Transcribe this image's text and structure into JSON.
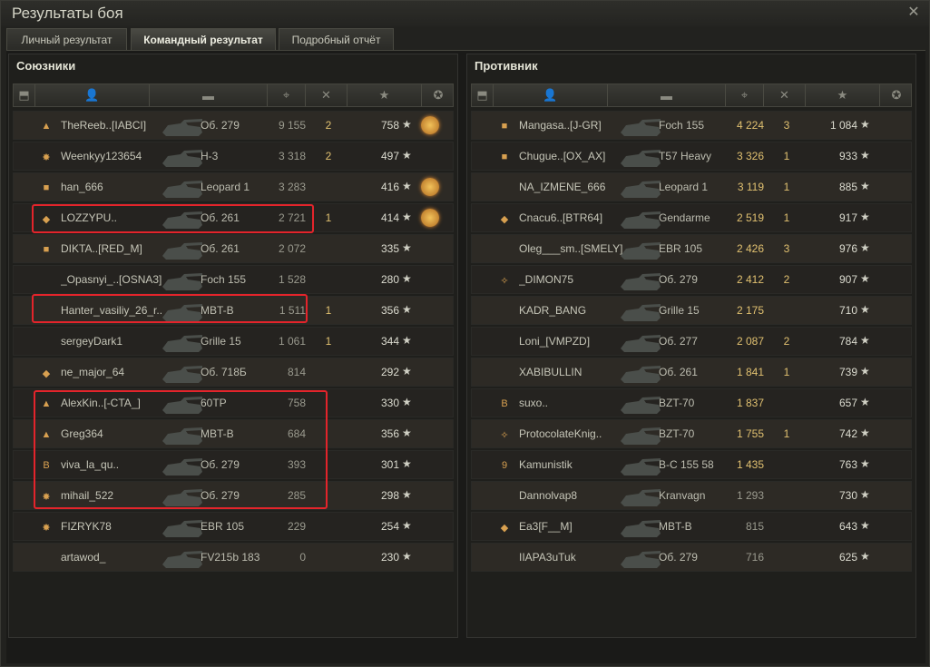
{
  "window": {
    "title": "Результаты боя"
  },
  "tabs": [
    {
      "label": "Личный результат"
    },
    {
      "label": "Командный результат"
    },
    {
      "label": "Подробный отчёт"
    }
  ],
  "allies": {
    "title": "Союзники",
    "rows": [
      {
        "name": "TheReeb..[IABCI]",
        "tank": "Об. 279",
        "damage": "9 155",
        "kills": "2",
        "xp": "758",
        "medal": true,
        "badge": "▲"
      },
      {
        "name": "Weenkyy123654",
        "tank": "Н-3",
        "damage": "3 318",
        "kills": "2",
        "xp": "497",
        "medal": false,
        "badge": "✸"
      },
      {
        "name": "han_666",
        "tank": "Leopard 1",
        "damage": "3 283",
        "kills": "",
        "xp": "416",
        "medal": true,
        "badge": "■"
      },
      {
        "name": "LOZZYPU..",
        "tank": "Об. 261",
        "damage": "2 721",
        "kills": "1",
        "xp": "414",
        "medal": true,
        "badge": "◆"
      },
      {
        "name": "DIKTA..[RED_M]",
        "tank": "Об. 261",
        "damage": "2 072",
        "kills": "",
        "xp": "335",
        "medal": false,
        "badge": "■"
      },
      {
        "name": "_Opasnyi_..[OSNA3]",
        "tank": "Foch 155",
        "damage": "1 528",
        "kills": "",
        "xp": "280",
        "medal": false,
        "badge": ""
      },
      {
        "name": "Hanter_vasiliy_26_r..",
        "tank": "MBT-B",
        "damage": "1 511",
        "kills": "1",
        "xp": "356",
        "medal": false,
        "badge": ""
      },
      {
        "name": "sergeyDark1",
        "tank": "Grille 15",
        "damage": "1 061",
        "kills": "1",
        "xp": "344",
        "medal": false,
        "badge": ""
      },
      {
        "name": "ne_major_64",
        "tank": "Об. 718Б",
        "damage": "814",
        "kills": "",
        "xp": "292",
        "medal": false,
        "badge": "◆"
      },
      {
        "name": "AlexKin..[-CTA_]",
        "tank": "60TP",
        "damage": "758",
        "kills": "",
        "xp": "330",
        "medal": false,
        "badge": "▲"
      },
      {
        "name": "Greg364",
        "tank": "MBT-B",
        "damage": "684",
        "kills": "",
        "xp": "356",
        "medal": false,
        "badge": "▲"
      },
      {
        "name": "viva_la_qu..",
        "tank": "Об. 279",
        "damage": "393",
        "kills": "",
        "xp": "301",
        "medal": false,
        "badge": "B"
      },
      {
        "name": "mihail_522",
        "tank": "Об. 279",
        "damage": "285",
        "kills": "",
        "xp": "298",
        "medal": false,
        "badge": "✸"
      },
      {
        "name": "FIZRYK78",
        "tank": "EBR 105",
        "damage": "229",
        "kills": "",
        "xp": "254",
        "medal": false,
        "badge": "✸"
      },
      {
        "name": "artawod_",
        "tank": "FV215b 183",
        "damage": "0",
        "kills": "",
        "xp": "230",
        "medal": false,
        "badge": ""
      }
    ]
  },
  "enemies": {
    "title": "Противник",
    "rows": [
      {
        "name": "Mangasa..[J-GR]",
        "tank": "Foch 155",
        "damage": "4 224",
        "kills": "3",
        "xp": "1 084",
        "badge": "■"
      },
      {
        "name": "Chugue..[OX_AX]",
        "tank": "T57 Heavy",
        "damage": "3 326",
        "kills": "1",
        "xp": "933",
        "badge": "■"
      },
      {
        "name": "NA_IZMENE_666",
        "tank": "Leopard 1",
        "damage": "3 119",
        "kills": "1",
        "xp": "885",
        "badge": ""
      },
      {
        "name": "Cnacu6..[BTR64]",
        "tank": "Gendarme",
        "damage": "2 519",
        "kills": "1",
        "xp": "917",
        "badge": "◆"
      },
      {
        "name": "Oleg___sm..[SMELY]",
        "tank": "EBR 105",
        "damage": "2 426",
        "kills": "3",
        "xp": "976",
        "badge": ""
      },
      {
        "name": "_DIMON75",
        "tank": "Об. 279",
        "damage": "2 412",
        "kills": "2",
        "xp": "907",
        "badge": "✧"
      },
      {
        "name": "KADR_BANG",
        "tank": "Grille 15",
        "damage": "2 175",
        "kills": "",
        "xp": "710",
        "badge": ""
      },
      {
        "name": "Loni_[VMPZD]",
        "tank": "Об. 277",
        "damage": "2 087",
        "kills": "2",
        "xp": "784",
        "badge": ""
      },
      {
        "name": "XABIBULLIN",
        "tank": "Об. 261",
        "damage": "1 841",
        "kills": "1",
        "xp": "739",
        "badge": ""
      },
      {
        "name": "suxo..",
        "tank": "BZT-70",
        "damage": "1 837",
        "kills": "",
        "xp": "657",
        "badge": "B"
      },
      {
        "name": "ProtocolateKnig..",
        "tank": "BZT-70",
        "damage": "1 755",
        "kills": "1",
        "xp": "742",
        "badge": "✧"
      },
      {
        "name": "Kamunistik",
        "tank": "B-C 155 58",
        "damage": "1 435",
        "kills": "",
        "xp": "763",
        "badge": "9"
      },
      {
        "name": "Dannolvap8",
        "tank": "Kranvagn",
        "damage": "1 293",
        "kills": "",
        "xp": "730",
        "badge": ""
      },
      {
        "name": "Ea3[F__M]",
        "tank": "MBT-B",
        "damage": "815",
        "kills": "",
        "xp": "643",
        "badge": "◆"
      },
      {
        "name": "IIAPA3uTuk",
        "tank": "Об. 279",
        "damage": "716",
        "kills": "",
        "xp": "625",
        "badge": ""
      }
    ]
  },
  "columns": {
    "star": "★"
  },
  "colors": {
    "highlight": "#e3242b",
    "gold": "#e0c070"
  }
}
